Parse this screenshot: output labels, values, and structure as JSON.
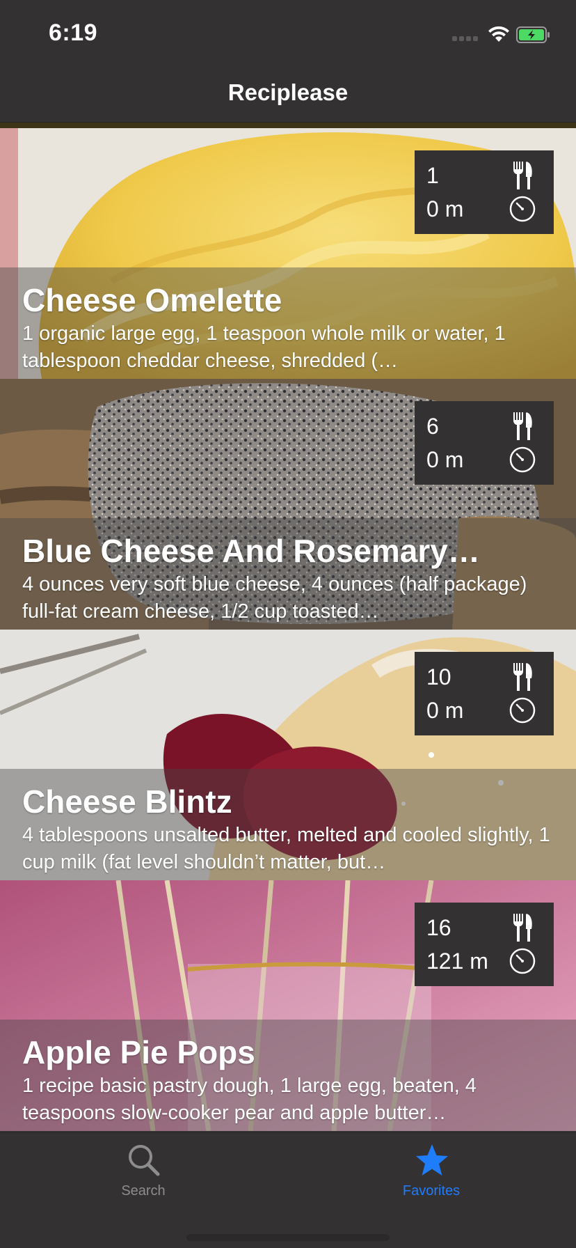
{
  "status_bar": {
    "time": "6:19"
  },
  "nav": {
    "title": "Reciplease"
  },
  "recipes": [
    {
      "title": "Cheese Omelette",
      "ingredients": "1 organic large egg, 1 teaspoon whole milk or water, 1 tablespoon cheddar cheese, shredded (…",
      "servings": "1",
      "time": "0 m"
    },
    {
      "title": "Blue Cheese And Rosemary…",
      "ingredients": "4 ounces very soft blue cheese, 4 ounces (half package) full-fat cream cheese, 1/2 cup toasted…",
      "servings": "6",
      "time": "0 m"
    },
    {
      "title": "Cheese Blintz",
      "ingredients": "4 tablespoons unsalted butter, melted and cooled slightly, 1 cup milk (fat level shouldn’t matter, but…",
      "servings": "10",
      "time": "0 m"
    },
    {
      "title": "Apple Pie Pops",
      "ingredients": "1 recipe basic pastry dough, 1 large egg, beaten, 4 teaspoons slow-cooker pear and apple butter…",
      "servings": "16",
      "time": "121 m"
    }
  ],
  "tab_bar": {
    "search_label": "Search",
    "favorites_label": "Favorites",
    "selected": "Favorites"
  },
  "icons": {
    "servings": "fork-knife-icon",
    "time": "timer-icon",
    "search": "magnifier-icon",
    "favorites": "star-icon"
  },
  "colors": {
    "background": "#333131",
    "accent": "#1f7dfc",
    "inactive_tab": "#8d8d8d"
  }
}
